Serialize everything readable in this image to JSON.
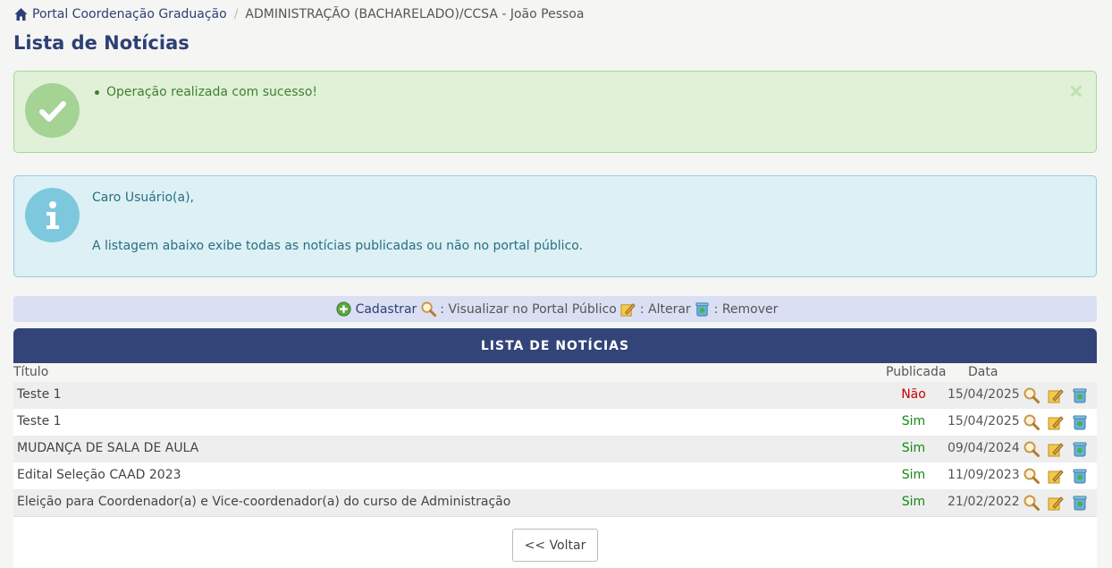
{
  "breadcrumb": {
    "home_label": "Portal Coordenação Graduação",
    "separator": "/",
    "current": "ADMINISTRAÇÃO (BACHARELADO)/CCSA - João Pessoa"
  },
  "page": {
    "title": "Lista de Notícias"
  },
  "alerts": {
    "success": {
      "message": "Operação realizada com sucesso!",
      "close": "×"
    },
    "info": {
      "line1": "Caro Usuário(a),",
      "line2": "A listagem abaixo exibe todas as notícias publicadas ou não no portal público."
    }
  },
  "legend": {
    "cadastrar": "Cadastrar",
    "visualizar": ": Visualizar no Portal Público",
    "alterar": ": Alterar",
    "remover": ": Remover"
  },
  "table": {
    "caption": "LISTA DE NOTÍCIAS",
    "columns": {
      "titulo": "Título",
      "publicada": "Publicada",
      "data": "Data"
    },
    "rows": [
      {
        "title": "Teste 1",
        "published": "Não",
        "date": "15/04/2025"
      },
      {
        "title": "Teste 1",
        "published": "Sim",
        "date": "15/04/2025"
      },
      {
        "title": "MUDANÇA DE SALA DE AULA",
        "published": "Sim",
        "date": "09/04/2024"
      },
      {
        "title": "Edital Seleção CAAD 2023",
        "published": "Sim",
        "date": "11/09/2023"
      },
      {
        "title": "Eleição para Coordenador(a) e Vice-coordenador(a) do curso de Administração",
        "published": "Sim",
        "date": "21/02/2022"
      }
    ]
  },
  "footer": {
    "back_label": "<< Voltar"
  },
  "colors": {
    "brand": "#334478",
    "success": "#41802f",
    "info": "#2a6f80",
    "no": "#cc0000",
    "yes": "#138a13"
  }
}
